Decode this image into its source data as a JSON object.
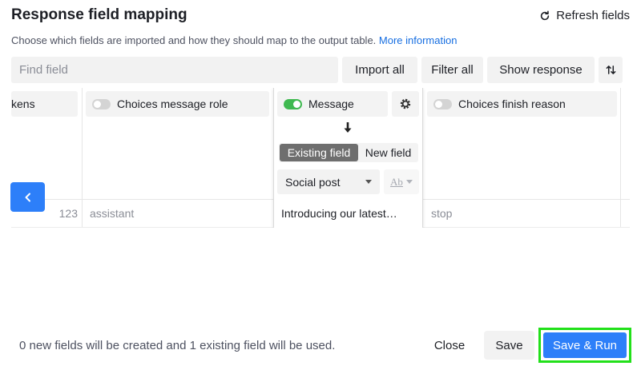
{
  "header": {
    "title": "Response field mapping",
    "refresh_label": "Refresh fields",
    "subtitle": "Choose which fields are imported and how they should map to the output table.",
    "more_info_link": "More information"
  },
  "toolbar": {
    "search_placeholder": "Find field",
    "import_all": "Import all",
    "filter_all": "Filter all",
    "show_response": "Show response",
    "sort_icon": "sort-arrows-icon"
  },
  "columns": [
    {
      "header": "kens",
      "toggle_on": false,
      "value": "123"
    },
    {
      "header": "Choices message role",
      "toggle_on": false,
      "value": "assistant"
    },
    {
      "header": "Message",
      "toggle_on": true,
      "value": "Introducing our latest…",
      "mapping": {
        "mode_selected": "Existing field",
        "mode_other": "New field",
        "target_field": "Social post",
        "type_icon": "long-text-icon",
        "type_label": "Ab"
      }
    },
    {
      "header": "Choices finish reason",
      "toggle_on": false,
      "value": "stop"
    }
  ],
  "footer": {
    "summary": "0 new fields will be created and 1 existing field will be used.",
    "close": "Close",
    "save": "Save",
    "save_run": "Save & Run"
  },
  "colors": {
    "accent": "#2d7ff9",
    "toggle_on": "#3fb950",
    "highlight": "#22e01a",
    "link": "#166ee1"
  }
}
